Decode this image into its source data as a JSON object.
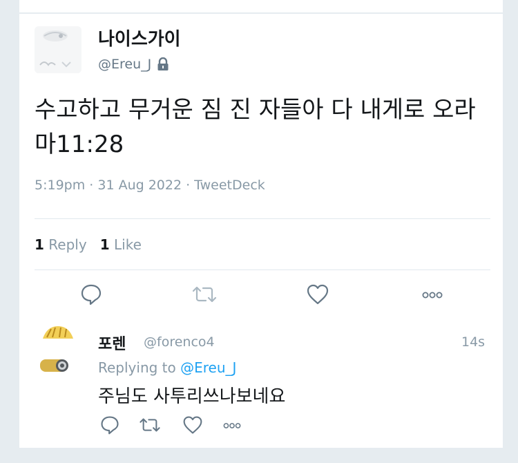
{
  "tweet": {
    "name": "나이스가이",
    "handle": "@Ereu_J",
    "protected_icon": "lock-icon",
    "text": "수고하고 무거운 짐 진 자들아 다 내게로 오라 마11:28",
    "timestamp": "5:19pm · 31 Aug 2022 · TweetDeck",
    "reply_count": "1",
    "reply_label": "Reply",
    "like_count": "1",
    "like_label": "Like",
    "actions": [
      "reply-icon",
      "retweet-icon",
      "like-icon",
      "more-icon"
    ]
  },
  "reply": {
    "name": "포렌",
    "handle": "@forenco4",
    "time": "14s",
    "replying_prefix": "Replying to",
    "replying_to": "@Ereu_J",
    "text": "주님도 사투리쓰나보네요",
    "actions": [
      "reply-icon",
      "retweet-icon",
      "like-icon",
      "more-icon"
    ]
  },
  "colors": {
    "background": "#e6ecf0",
    "text": "#14171a",
    "muted": "#8899a6",
    "link": "#1da1f2",
    "icon": "#657786",
    "retweet_icon": "#aab8c2"
  }
}
